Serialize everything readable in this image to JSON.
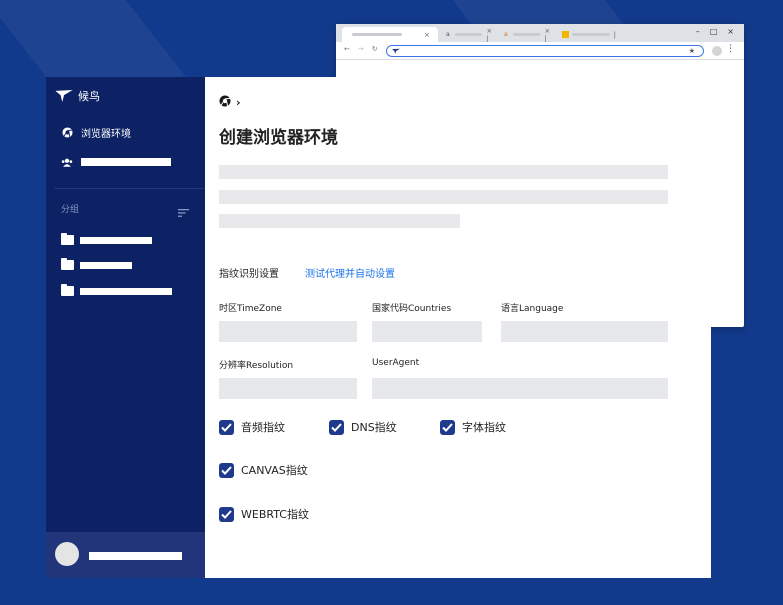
{
  "colors": {
    "background": "#123a8c",
    "sidebar": "#0d2264",
    "sidebar_footer": "#22347a",
    "accent_link": "#1a73e8",
    "checkbox": "#1f3a8c",
    "placeholder": "#e9e9ec"
  },
  "browser_window": {
    "tab_icons": [
      "chrome-tab-icon",
      "amazon-a-icon",
      "amazon-a-icon",
      "colored-tile-icon"
    ],
    "window_controls": [
      "–",
      "□",
      "×"
    ]
  },
  "sidebar": {
    "app_name": "候鸟",
    "items": [
      {
        "label": "浏览器环境",
        "icon": "chrome-icon"
      },
      {
        "label": "",
        "icon": "users-icon"
      }
    ],
    "group_label": "分组",
    "folders": [
      {
        "icon": "folder-icon"
      },
      {
        "icon": "folder-icon"
      },
      {
        "icon": "folder-icon"
      }
    ]
  },
  "main": {
    "breadcrumb_chevron": "›",
    "title": "创建浏览器环境",
    "fingerprint_section": "指纹识别设置",
    "test_proxy_link": "测试代理并自动设置",
    "fields": {
      "timezone": "时区TimeZone",
      "countries": "国家代码Countries",
      "language": "语言Language",
      "resolution": "分辨率Resolution",
      "useragent": "UserAgent"
    },
    "checkboxes": {
      "audio": {
        "label": "音频指纹",
        "checked": true
      },
      "dns": {
        "label": "DNS指纹",
        "checked": true
      },
      "font": {
        "label": "字体指纹",
        "checked": true
      },
      "canvas": {
        "label": "CANVAS指纹",
        "checked": true
      },
      "webrtc": {
        "label": "WEBRTC指纹",
        "checked": true
      }
    }
  }
}
